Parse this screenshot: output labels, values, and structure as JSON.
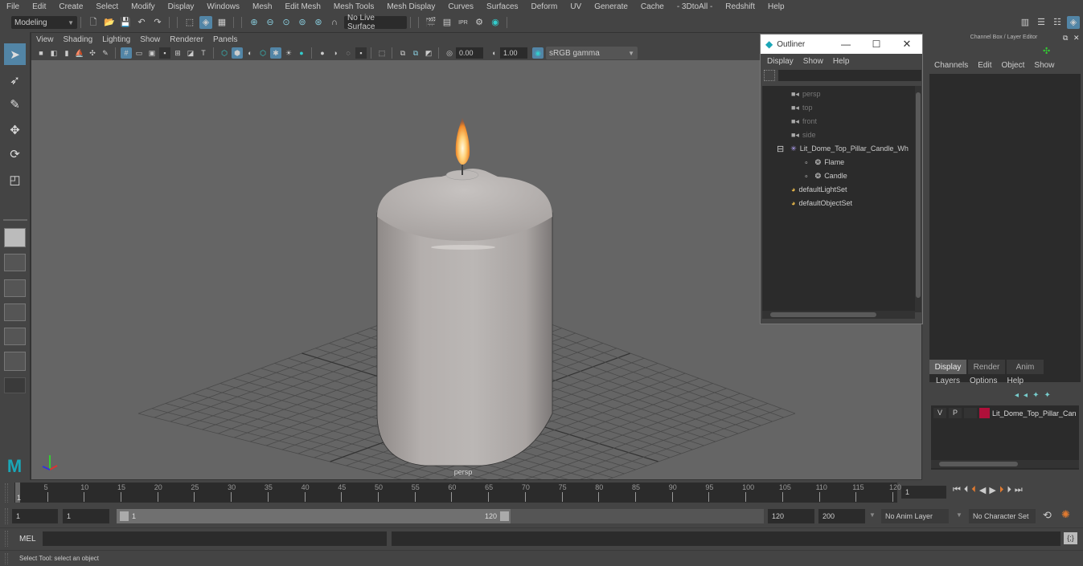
{
  "menubar": {
    "items": [
      "File",
      "Edit",
      "Create",
      "Select",
      "Modify",
      "Display",
      "Windows",
      "Mesh",
      "Edit Mesh",
      "Mesh Tools",
      "Mesh Display",
      "Curves",
      "Surfaces",
      "Deform",
      "UV",
      "Generate",
      "Cache",
      "- 3DtoAll -",
      "Redshift",
      "Help"
    ]
  },
  "shelf": {
    "mode": "Modeling",
    "live_surface": "No Live Surface"
  },
  "viewport": {
    "menu": [
      "View",
      "Shading",
      "Lighting",
      "Show",
      "Renderer",
      "Panels"
    ],
    "exposure": "0.00",
    "gamma": "1.00",
    "color_space": "sRGB gamma",
    "camera_label": "persp"
  },
  "outliner": {
    "title": "Outliner",
    "menu": [
      "Display",
      "Show",
      "Help"
    ],
    "search_value": "",
    "items": [
      {
        "label": "persp",
        "type": "camera",
        "dim": true
      },
      {
        "label": "top",
        "type": "camera",
        "dim": true
      },
      {
        "label": "front",
        "type": "camera",
        "dim": true
      },
      {
        "label": "side",
        "type": "camera",
        "dim": true
      },
      {
        "label": "Lit_Dome_Top_Pillar_Candle_Wh",
        "type": "group",
        "expanded": true
      },
      {
        "label": "Flame",
        "type": "mesh",
        "child": true
      },
      {
        "label": "Candle",
        "type": "mesh",
        "child": true
      },
      {
        "label": "defaultLightSet",
        "type": "set"
      },
      {
        "label": "defaultObjectSet",
        "type": "set"
      }
    ]
  },
  "channel_box": {
    "title": "Channel Box / Layer Editor",
    "menu": [
      "Channels",
      "Edit",
      "Object",
      "Show"
    ],
    "tabs": [
      "Display",
      "Render",
      "Anim"
    ],
    "active_tab": "Display",
    "layer_menu": [
      "Layers",
      "Options",
      "Help"
    ],
    "layer": {
      "v": "V",
      "p": "P",
      "color": "#b0103a",
      "name": "Lit_Dome_Top_Pillar_Can"
    }
  },
  "timeline": {
    "ticks": [
      "5",
      "10",
      "15",
      "20",
      "25",
      "30",
      "35",
      "40",
      "45",
      "50",
      "55",
      "60",
      "65",
      "70",
      "75",
      "80",
      "85",
      "90",
      "95",
      "100",
      "105",
      "110",
      "115",
      "120"
    ],
    "current_frame_marker": "1",
    "current_frame": "1"
  },
  "range": {
    "start": "1",
    "anim_start": "1",
    "slider_start": "1",
    "slider_end": "120",
    "anim_end": "120",
    "end": "200",
    "anim_layer": "No Anim Layer",
    "character_set": "No Character Set"
  },
  "mel": {
    "label": "MEL",
    "value": ""
  },
  "status": {
    "text": "Select Tool: select an object"
  }
}
